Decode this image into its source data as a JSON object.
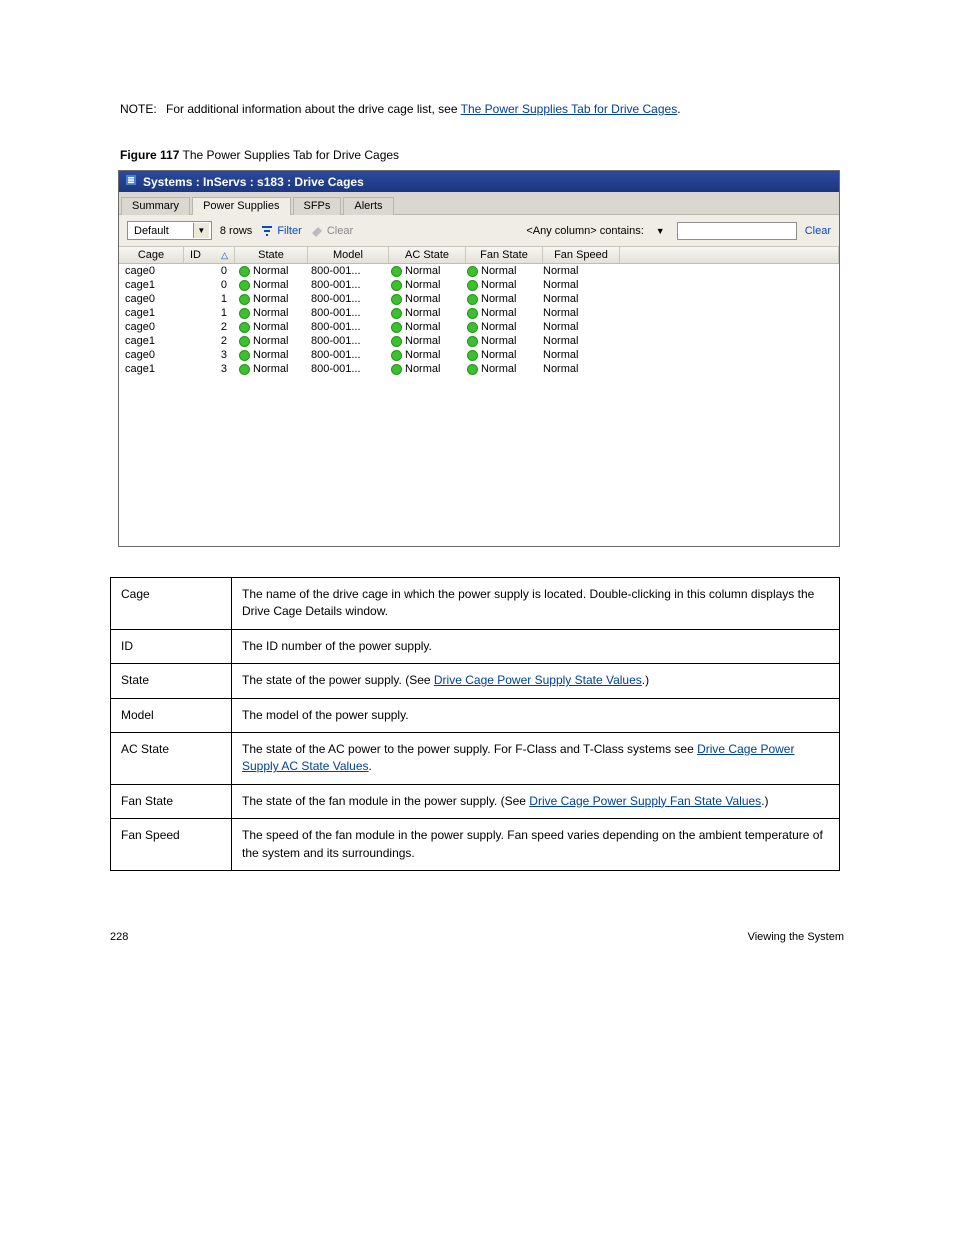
{
  "note": {
    "label": "NOTE:",
    "text_before": "For additional information about the drive cage list, see ",
    "link_text": "The Power Supplies Tab for Drive Cages",
    "text_after": "."
  },
  "figure": {
    "label": "Figure 117",
    "title": "The Power Supplies Tab for Drive Cages"
  },
  "window": {
    "title": "Systems : InServs : s183 : Drive Cages",
    "tabs": [
      "Summary",
      "Power Supplies",
      "SFPs",
      "Alerts"
    ],
    "active_tab_index": 1,
    "toolbar": {
      "dropdown_value": "Default",
      "rows_text": "8 rows",
      "filter_label": "Filter",
      "clear_label": "Clear",
      "search_label": "<Any column> contains:",
      "clear_link": "Clear"
    },
    "columns": [
      "Cage",
      "ID",
      "State",
      "Model",
      "AC State",
      "Fan State",
      "Fan Speed"
    ],
    "sort_col_index": 1,
    "rows": [
      {
        "cage": "cage0",
        "id": "0",
        "state": "Normal",
        "model": "800-001...",
        "ac": "Normal",
        "fstate": "Normal",
        "fspeed": "Normal"
      },
      {
        "cage": "cage1",
        "id": "0",
        "state": "Normal",
        "model": "800-001...",
        "ac": "Normal",
        "fstate": "Normal",
        "fspeed": "Normal"
      },
      {
        "cage": "cage0",
        "id": "1",
        "state": "Normal",
        "model": "800-001...",
        "ac": "Normal",
        "fstate": "Normal",
        "fspeed": "Normal"
      },
      {
        "cage": "cage1",
        "id": "1",
        "state": "Normal",
        "model": "800-001...",
        "ac": "Normal",
        "fstate": "Normal",
        "fspeed": "Normal"
      },
      {
        "cage": "cage0",
        "id": "2",
        "state": "Normal",
        "model": "800-001...",
        "ac": "Normal",
        "fstate": "Normal",
        "fspeed": "Normal"
      },
      {
        "cage": "cage1",
        "id": "2",
        "state": "Normal",
        "model": "800-001...",
        "ac": "Normal",
        "fstate": "Normal",
        "fspeed": "Normal"
      },
      {
        "cage": "cage0",
        "id": "3",
        "state": "Normal",
        "model": "800-001...",
        "ac": "Normal",
        "fstate": "Normal",
        "fspeed": "Normal"
      },
      {
        "cage": "cage1",
        "id": "3",
        "state": "Normal",
        "model": "800-001...",
        "ac": "Normal",
        "fstate": "Normal",
        "fspeed": "Normal"
      }
    ]
  },
  "desc": [
    {
      "k": "Cage",
      "v": "The name of the drive cage in which the power supply is located. Double-clicking in this column displays the Drive Cage Details window."
    },
    {
      "k": "ID",
      "v": "The ID number of the power supply."
    },
    {
      "k": "State",
      "v_pre": "The state of the power supply. (See ",
      "v_link": "Drive Cage Power Supply State Values",
      "v_post": ".)"
    },
    {
      "k": "Model",
      "v": "The model of the power supply."
    },
    {
      "k": "AC State",
      "v_pre": "The state of the AC power to the power supply. For F-Class and T-Class systems see ",
      "v_link": "Drive Cage Power Supply AC State Values",
      "v_post": "."
    },
    {
      "k": "Fan State",
      "v_pre": "The state of the fan module in the power supply. (See ",
      "v_link": "Drive Cage Power Supply Fan State Values",
      "v_post": ".)"
    },
    {
      "k": "Fan Speed",
      "v": "The speed of the fan module in the power supply. Fan speed varies depending on the ambient temperature of the system and its surroundings."
    }
  ],
  "footer": {
    "left": "228",
    "right": "Viewing the System"
  }
}
